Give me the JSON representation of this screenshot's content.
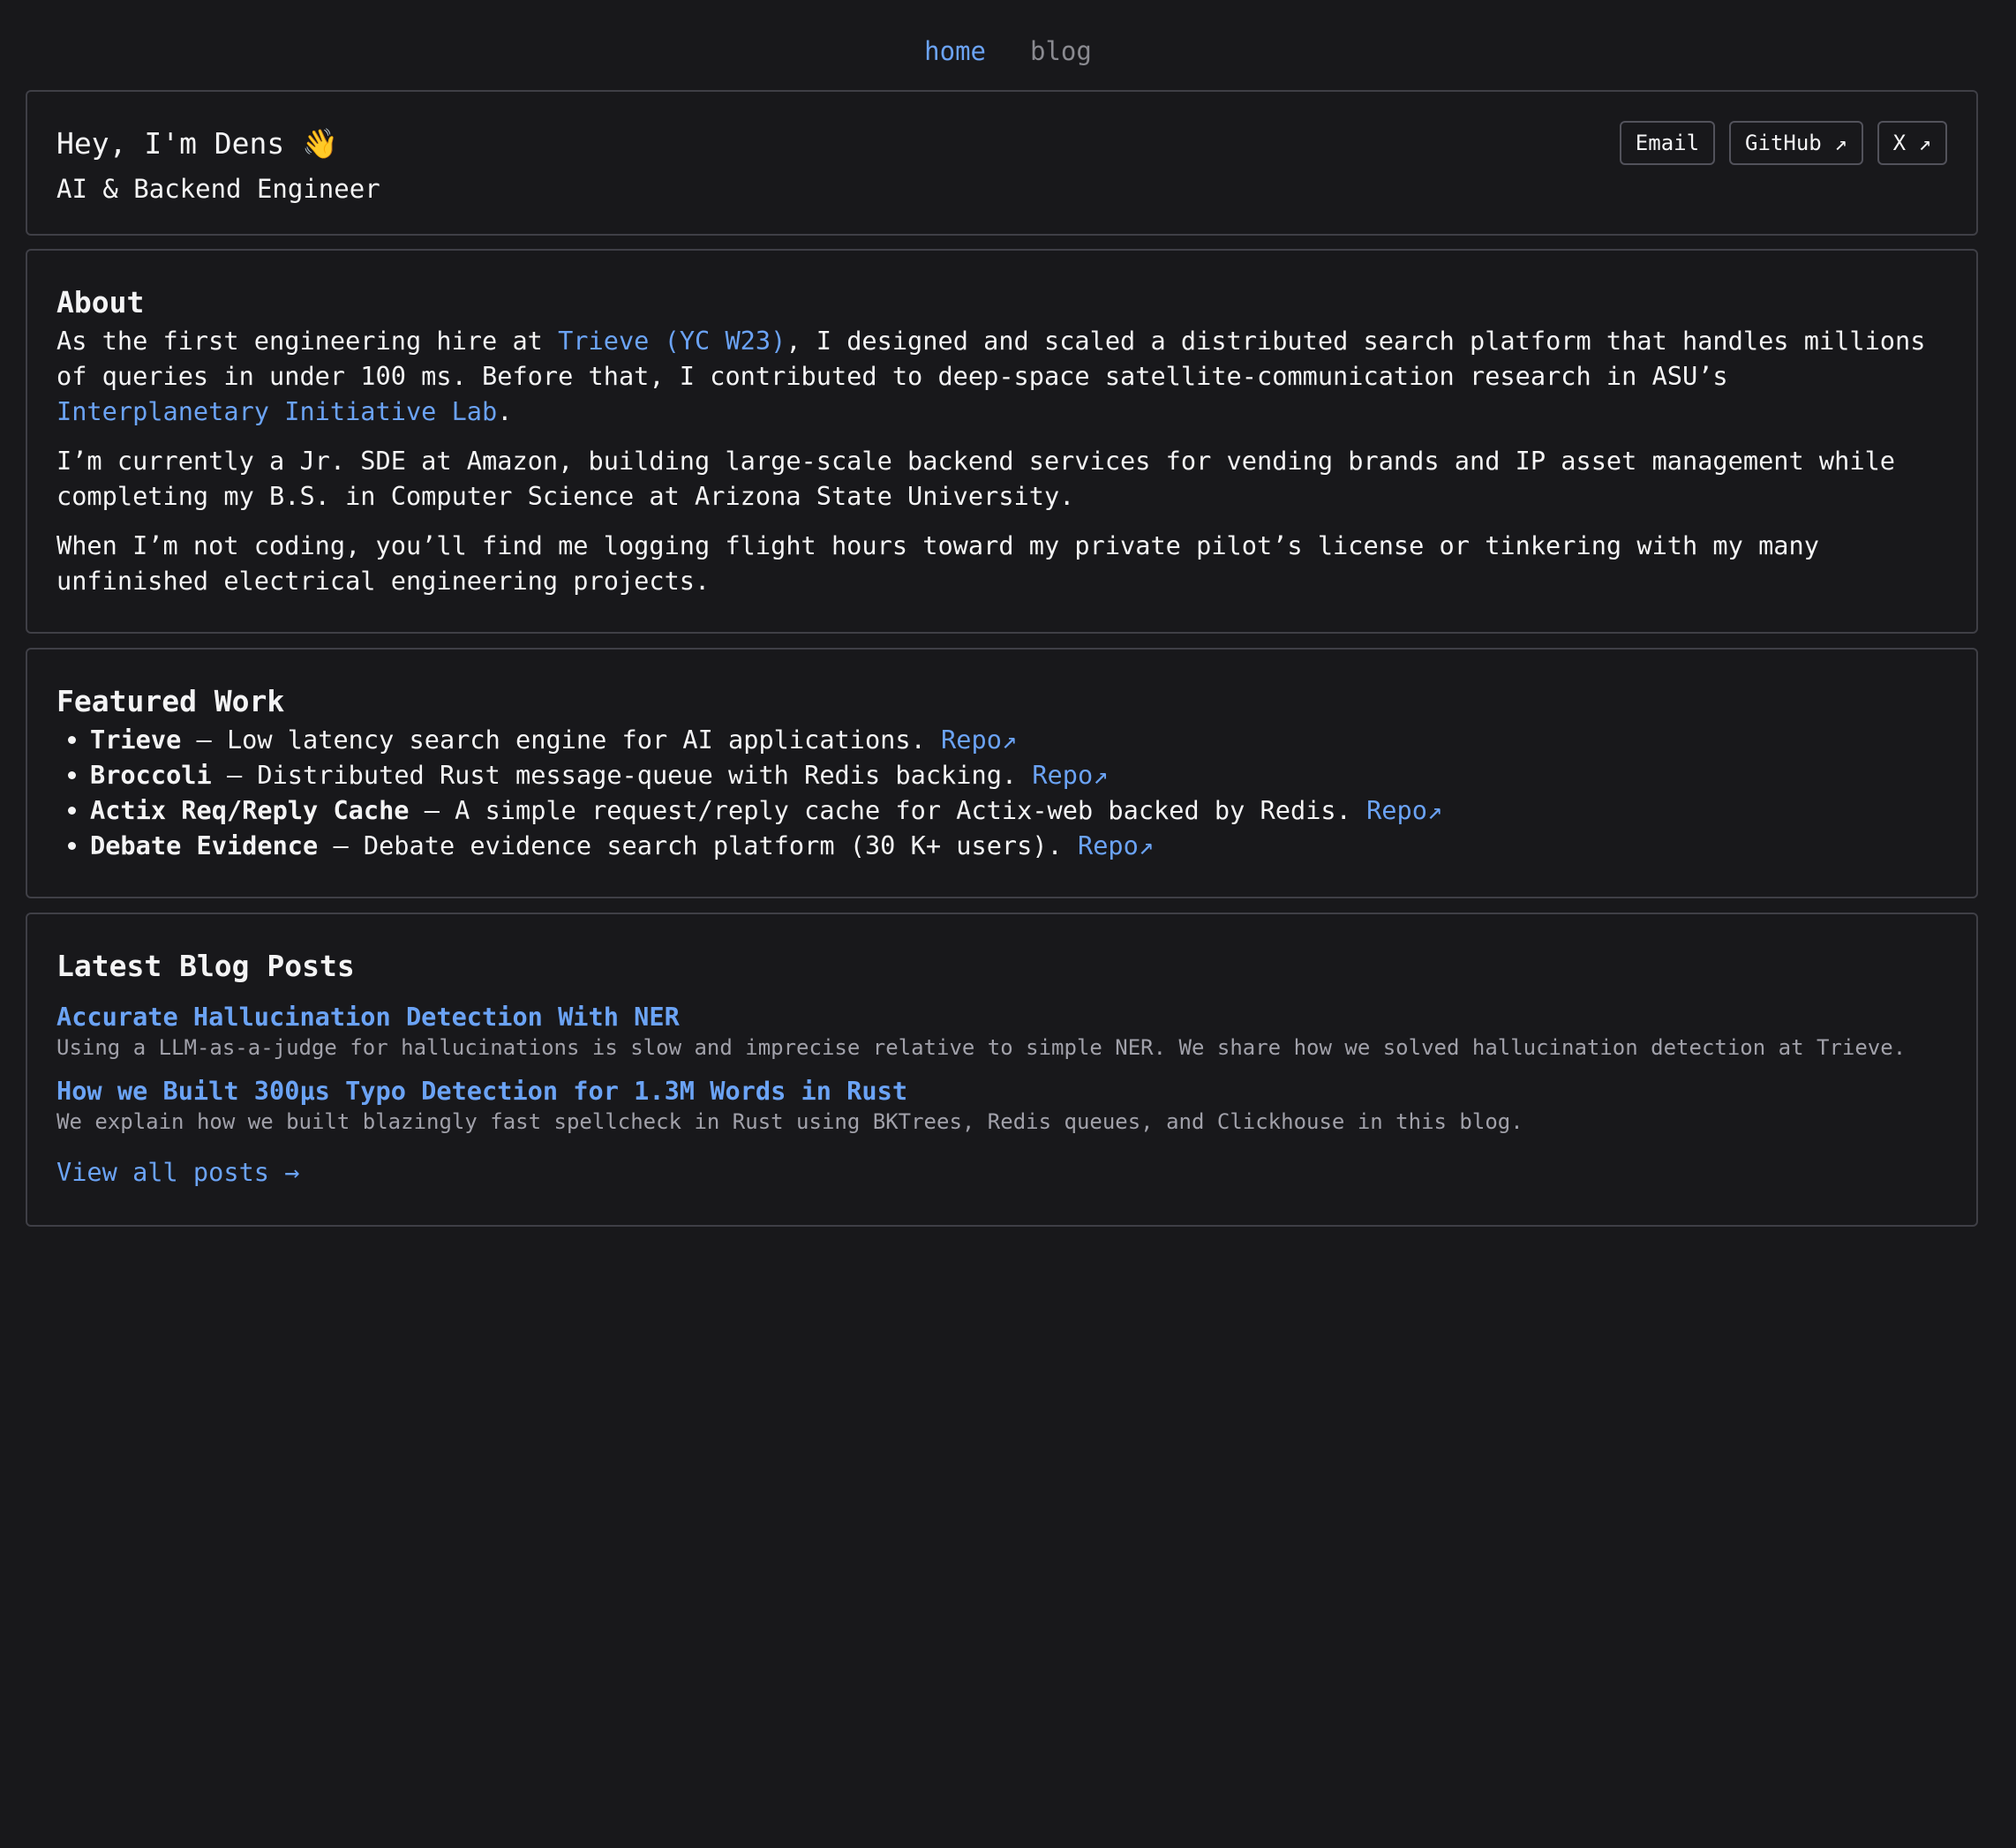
{
  "nav": {
    "home": "home",
    "blog": "blog"
  },
  "hero": {
    "title": "Hey, I'm Dens 👋",
    "subtitle": "AI & Backend Engineer",
    "links": {
      "email": "Email",
      "github": "GitHub ↗",
      "x": "X ↗"
    }
  },
  "about": {
    "title": "About",
    "p1_before": "As the first engineering hire at ",
    "p1_link1": "Trieve (YC W23)",
    "p1_middle": ", I designed and scaled a distributed search platform that handles millions of queries in under 100 ms. Before that, I contributed to deep-space satellite-communication research in ASU’s ",
    "p1_link2": "Interplanetary Initiative Lab",
    "p1_after": ".",
    "p2": "I’m currently a Jr. SDE at Amazon, building large-scale backend services for vending brands and IP asset management while completing my B.S. in Computer Science at Arizona State University.",
    "p3": "When I’m not coding, you’ll find me logging flight hours toward my private pilot’s license or tinkering with my many unfinished electrical engineering projects."
  },
  "featured": {
    "title": "Featured Work",
    "items": [
      {
        "name": "Trieve",
        "desc": " — Low latency search engine for AI applications. ",
        "link": "Repo↗"
      },
      {
        "name": "Broccoli",
        "desc": " — Distributed Rust message-queue with Redis backing. ",
        "link": "Repo↗"
      },
      {
        "name": "Actix Req/Reply Cache",
        "desc": " — A simple request/reply cache for Actix-web backed by Redis. ",
        "link": "Repo↗"
      },
      {
        "name": "Debate Evidence",
        "desc": " — Debate evidence search platform (30 K+ users). ",
        "link": "Repo↗"
      }
    ]
  },
  "blog": {
    "title": "Latest Blog Posts",
    "posts": [
      {
        "title": "Accurate Hallucination Detection With NER",
        "desc": "Using a LLM-as-a-judge for hallucinations is slow and imprecise relative to simple NER. We share how we solved hallucination detection at Trieve."
      },
      {
        "title": "How we Built 300μs Typo Detection for 1.3M Words in Rust",
        "desc": "We explain how we built blazingly fast spellcheck in Rust using BKTrees, Redis queues, and Clickhouse in this blog."
      }
    ],
    "view_all": "View all posts →"
  },
  "colors": {
    "background": "#18181b",
    "accent": "#6ba3f5",
    "border": "#3f3f46",
    "muted": "#a1a1aa"
  }
}
